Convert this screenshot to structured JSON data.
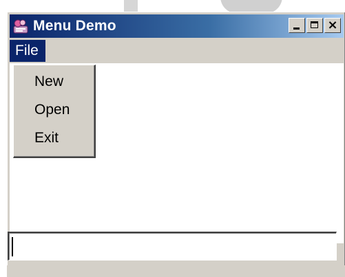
{
  "window": {
    "title": "Menu Demo",
    "icon": "java-app-icon",
    "controls": {
      "minimize": "minimize-icon",
      "maximize": "maximize-icon",
      "close": "×"
    }
  },
  "menubar": {
    "items": [
      {
        "label": "File",
        "active": true
      }
    ]
  },
  "dropdown": {
    "items": [
      {
        "label": "New"
      },
      {
        "label": "Open"
      },
      {
        "label": "Exit"
      }
    ]
  },
  "textfield": {
    "value": "",
    "placeholder": ""
  },
  "colors": {
    "titlebar_start": "#0a246a",
    "titlebar_end": "#a6caf0",
    "menu_highlight": "#0a246a",
    "chrome": "#d4d0c8"
  }
}
